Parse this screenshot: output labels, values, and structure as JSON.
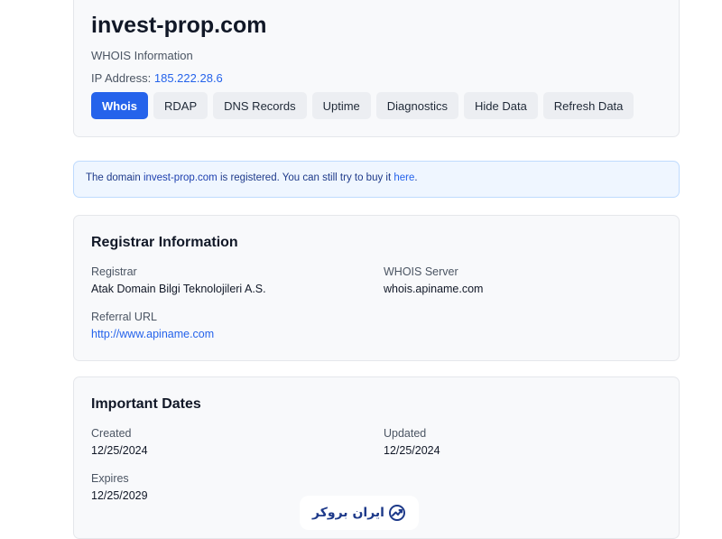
{
  "header": {
    "domain": "invest-prop.com",
    "subtitle": "WHOIS Information",
    "ip_label": "IP Address:",
    "ip_value": "185.222.28.6",
    "tabs": [
      {
        "label": "Whois",
        "active": true
      },
      {
        "label": "RDAP"
      },
      {
        "label": "DNS Records"
      },
      {
        "label": "Uptime"
      },
      {
        "label": "Diagnostics"
      },
      {
        "label": "Hide Data"
      },
      {
        "label": "Refresh Data"
      }
    ]
  },
  "notice": {
    "prefix": "The domain",
    "domain": "invest-prop.com",
    "middle": "is registered. You can still try to buy it",
    "link": "here",
    "suffix": "."
  },
  "registrar": {
    "title": "Registrar Information",
    "registrar_label": "Registrar",
    "registrar_value": "Atak Domain Bilgi Teknolojileri A.S.",
    "whois_label": "WHOIS Server",
    "whois_value": "whois.apiname.com",
    "referral_label": "Referral URL",
    "referral_value": "http://www.apiname.com"
  },
  "dates": {
    "title": "Important Dates",
    "created_label": "Created",
    "created_value": "12/25/2024",
    "updated_label": "Updated",
    "updated_value": "12/25/2024",
    "expires_label": "Expires",
    "expires_value": "12/25/2029"
  },
  "watermark": {
    "text": "ایران بروکر",
    "icon": "chart-trend-icon"
  },
  "colors": {
    "accent": "#2563eb",
    "notice_bg": "#eff6ff",
    "card_bg": "#f8f9fb"
  }
}
